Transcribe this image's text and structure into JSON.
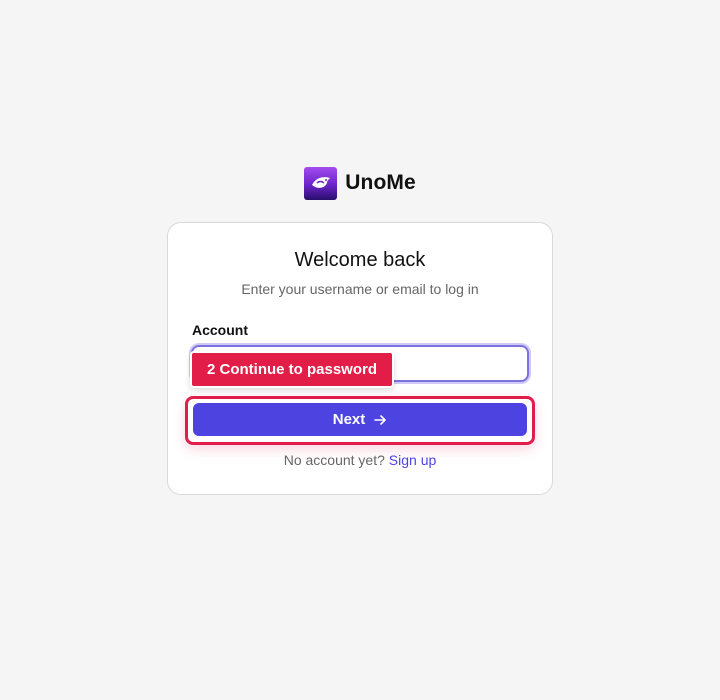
{
  "brand": {
    "name": "UnoMe",
    "logo_icon": "bird-logo-icon"
  },
  "card": {
    "title": "Welcome back",
    "subtitle": "Enter your username or email to log in",
    "account_label": "Account",
    "account_value": "",
    "next_label": "Next",
    "next_icon": "arrow-right-icon",
    "no_account_text": "No account yet?",
    "signup_label": "Sign up"
  },
  "annotation": {
    "label": "2 Continue to password"
  },
  "colors": {
    "accent": "#4c43e0",
    "highlight": "#df1e4c",
    "logo_top": "#a34cf0",
    "logo_bottom": "#2a0f6b"
  }
}
